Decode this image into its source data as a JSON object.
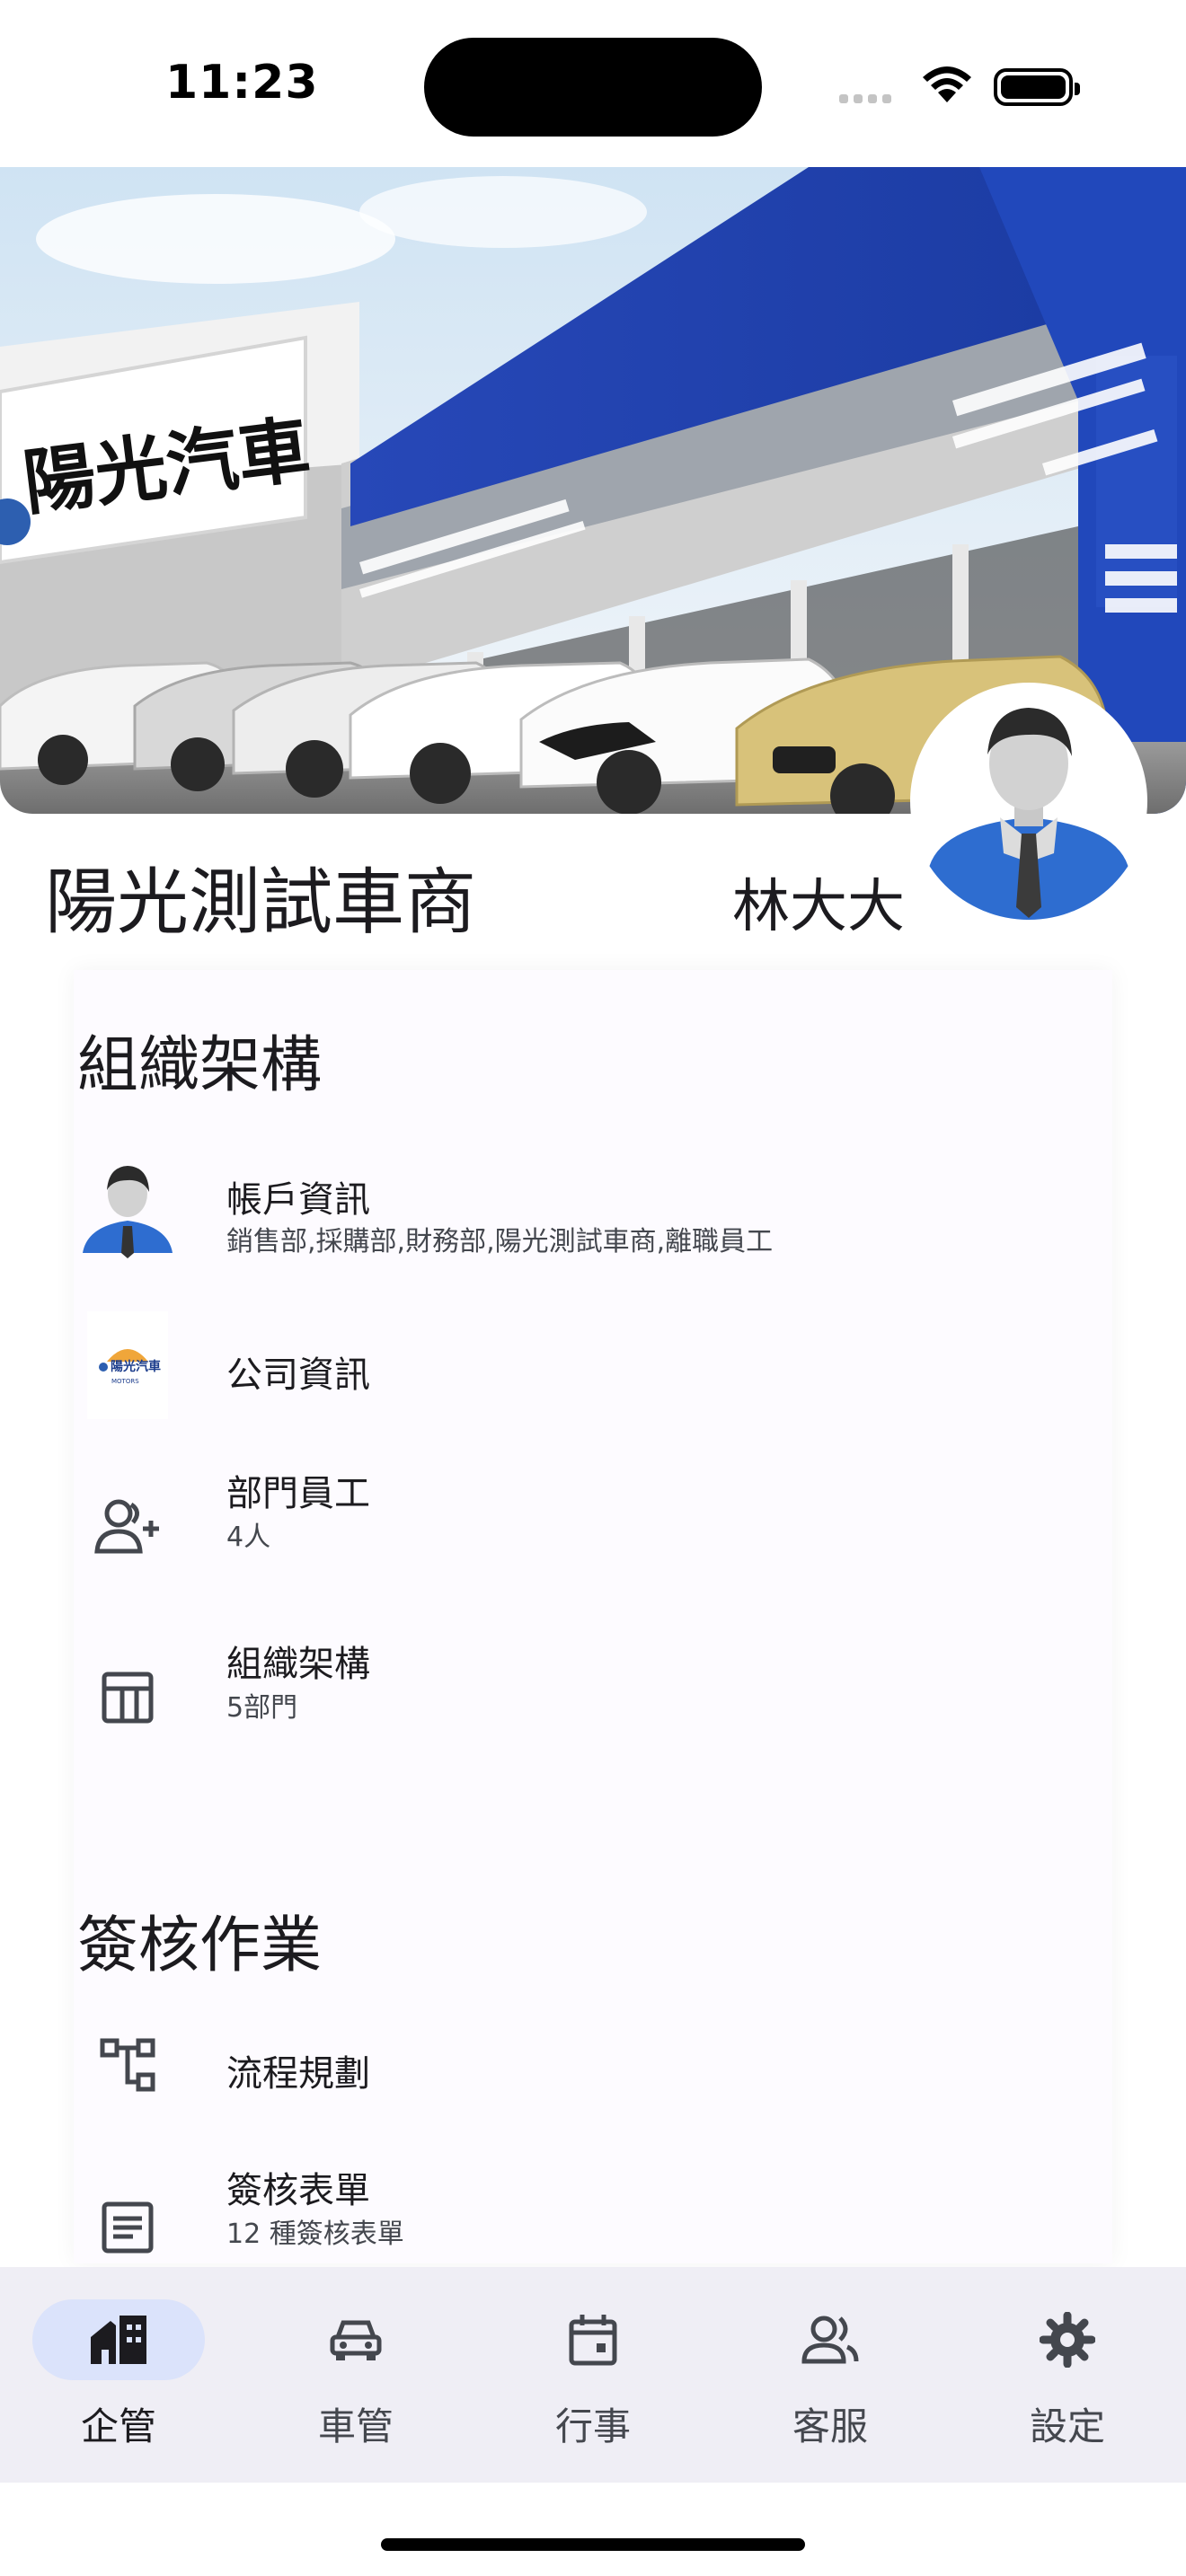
{
  "status_bar": {
    "time": "11:23"
  },
  "banner": {
    "sign_text": "陽光汽車"
  },
  "profile": {
    "company_name": "陽光測試車商",
    "user_name": "林大大"
  },
  "sections": {
    "org": {
      "title": "組織架構",
      "items": [
        {
          "title": "帳戶資訊",
          "subtitle": "銷售部,採購部,財務部,陽光測試車商,離職員工",
          "icon": "person-avatar"
        },
        {
          "title": "公司資訊",
          "subtitle": "",
          "icon": "company-logo",
          "logo_text": "陽光汽車",
          "logo_sub": "MOTORS"
        },
        {
          "title": "部門員工",
          "subtitle": "4人",
          "icon": "person-add-icon"
        },
        {
          "title": "組織架構",
          "subtitle": "5部門",
          "icon": "table-chart-icon"
        }
      ]
    },
    "approval": {
      "title": "簽核作業",
      "items": [
        {
          "title": "流程規劃",
          "subtitle": "",
          "icon": "account-tree-icon"
        },
        {
          "title": "簽核表單",
          "subtitle": "12 種簽核表單",
          "icon": "article-icon"
        }
      ]
    }
  },
  "nav": {
    "items": [
      {
        "label": "企管",
        "icon": "enterprise-icon",
        "active": true
      },
      {
        "label": "車管",
        "icon": "car-icon",
        "active": false
      },
      {
        "label": "行事",
        "icon": "calendar-icon",
        "active": false
      },
      {
        "label": "客服",
        "icon": "customer-service-icon",
        "active": false
      },
      {
        "label": "設定",
        "icon": "settings-gear-icon",
        "active": false
      }
    ]
  },
  "colors": {
    "accent": "#dbe3fb",
    "nav_bg": "#efeef5",
    "banner_blue": "#1f3fa8",
    "text": "#1c1b1f"
  }
}
